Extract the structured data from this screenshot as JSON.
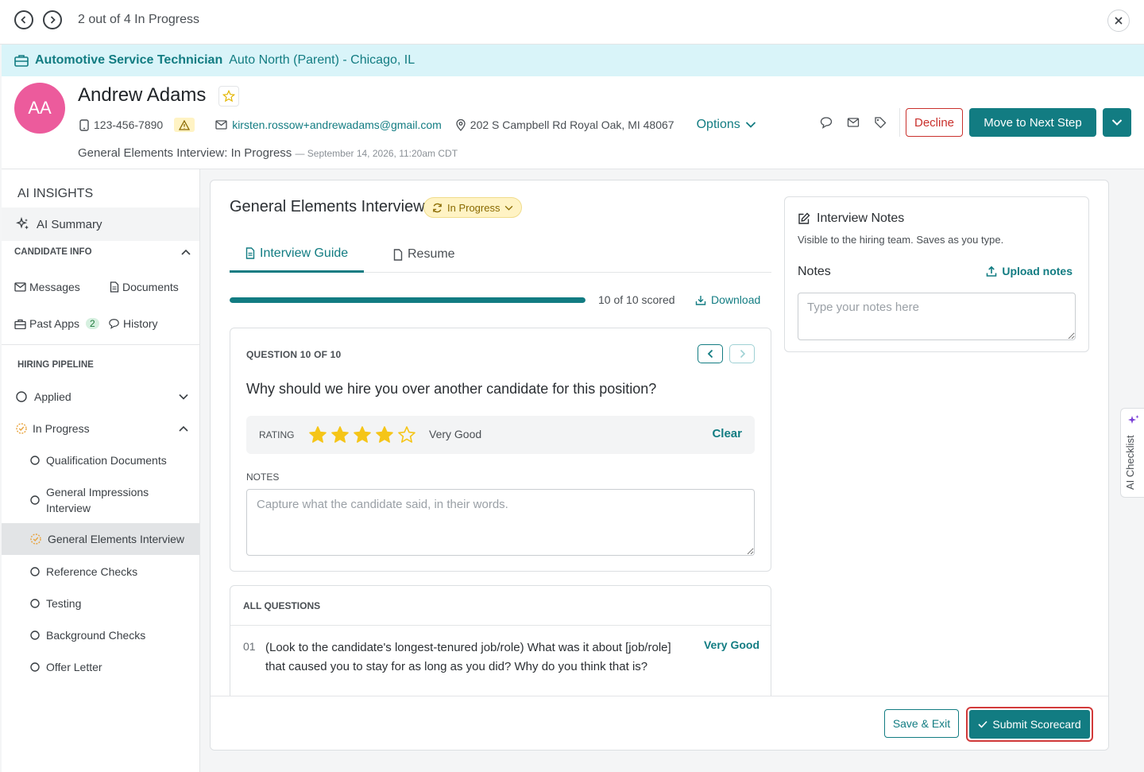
{
  "topbar": {
    "progress_label": "2 out of 4 In Progress"
  },
  "job": {
    "title": "Automotive Service Technician",
    "location": "Auto North (Parent) - Chicago, IL"
  },
  "candidate": {
    "initials": "AA",
    "name": "Andrew Adams",
    "phone": "123-456-7890",
    "email": "kirsten.rossow+andrewadams@gmail.com",
    "address": "202 S Campbell Rd Royal Oak, MI 48067",
    "options_label": "Options",
    "status": "General Elements Interview: In Progress",
    "status_date": "— September 14, 2026, 11:20am CDT",
    "avatar_color": "#ec5b9c"
  },
  "actions": {
    "decline": "Decline",
    "next_step": "Move to Next Step"
  },
  "sidebar": {
    "ai_insights": "AI INSIGHTS",
    "ai_summary": "AI Summary",
    "candidate_info": "CANDIDATE INFO",
    "messages": "Messages",
    "documents": "Documents",
    "past_apps": "Past Apps",
    "past_apps_count": "2",
    "history": "History",
    "hiring_pipeline": "HIRING PIPELINE",
    "stages": [
      {
        "label": "Applied"
      },
      {
        "label": "In Progress"
      },
      {
        "label": "Qualification Documents"
      },
      {
        "label": "General Impressions Interview"
      },
      {
        "label": "General Elements Interview"
      },
      {
        "label": "Reference Checks"
      },
      {
        "label": "Testing"
      },
      {
        "label": "Background Checks"
      },
      {
        "label": "Offer Letter"
      }
    ]
  },
  "interview": {
    "title": "General Elements Interview",
    "status": "In Progress",
    "tabs": {
      "guide": "Interview Guide",
      "resume": "Resume"
    },
    "progress": 1.0,
    "scored_text": "10 of 10 scored",
    "download": "Download",
    "question": {
      "label": "QUESTION 10 OF 10",
      "text": "Why should we hire you over another candidate for this position?",
      "rating_label": "RATING",
      "rating": 4,
      "rating_max": 5,
      "rating_text": "Very Good",
      "clear": "Clear",
      "notes_label": "NOTES",
      "notes_placeholder": "Capture what the candidate said, in their words."
    },
    "all_questions": {
      "header": "ALL QUESTIONS",
      "items": [
        {
          "num": "01",
          "text": "(Look to the candidate's longest-tenured job/role) What was it about [job/role] that caused you to stay for as long as you did? Why do you think that is?",
          "rating": "Very Good"
        }
      ]
    }
  },
  "notes_panel": {
    "title": "Interview Notes",
    "subtitle": "Visible to the hiring team. Saves as you type.",
    "notes_label": "Notes",
    "upload": "Upload notes",
    "placeholder": "Type your notes here"
  },
  "footer": {
    "save_exit": "Save & Exit",
    "submit": "Submit Scorecard"
  },
  "ai_checklist": "AI Checklist",
  "colors": {
    "accent": "#127c82",
    "decline": "#c9302c",
    "star": "#f5c518"
  }
}
